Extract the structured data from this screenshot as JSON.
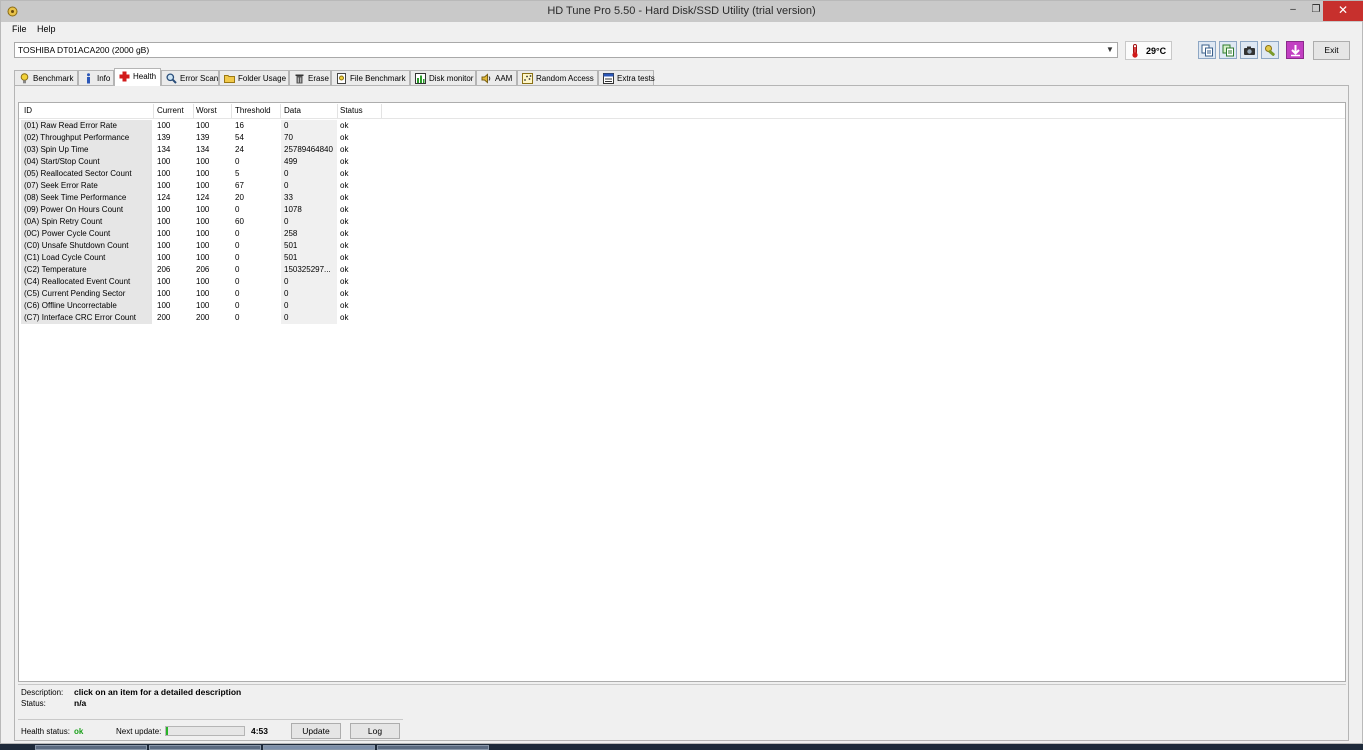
{
  "window": {
    "title": "HD Tune Pro 5.50 - Hard Disk/SSD Utility (trial version)",
    "close_glyph": "✕",
    "min_glyph": "–",
    "max_glyph": "❐"
  },
  "menu": {
    "file": "File",
    "help": "Help"
  },
  "drive": {
    "selected": "TOSHIBA DT01ACA200 (2000 gB)"
  },
  "temperature": {
    "value": "29°C"
  },
  "toolbar": {
    "exit_label": "Exit"
  },
  "tabs": [
    {
      "label": "Benchmark",
      "icon": "lightbulb-icon"
    },
    {
      "label": "Info",
      "icon": "info-icon"
    },
    {
      "label": "Health",
      "icon": "health-cross-icon",
      "active": true
    },
    {
      "label": "Error Scan",
      "icon": "magnifier-icon"
    },
    {
      "label": "Folder Usage",
      "icon": "folder-icon"
    },
    {
      "label": "Erase",
      "icon": "trash-icon"
    },
    {
      "label": "File Benchmark",
      "icon": "file-benchmark-icon"
    },
    {
      "label": "Disk monitor",
      "icon": "chart-icon"
    },
    {
      "label": "AAM",
      "icon": "speaker-icon"
    },
    {
      "label": "Random Access",
      "icon": "random-access-icon"
    },
    {
      "label": "Extra tests",
      "icon": "extra-tests-icon"
    }
  ],
  "table": {
    "headers": [
      "ID",
      "Current",
      "Worst",
      "Threshold",
      "Data",
      "Status"
    ],
    "rows": [
      [
        "(01) Raw Read Error Rate",
        "100",
        "100",
        "16",
        "0",
        "ok"
      ],
      [
        "(02) Throughput Performance",
        "139",
        "139",
        "54",
        "70",
        "ok"
      ],
      [
        "(03) Spin Up Time",
        "134",
        "134",
        "24",
        "25789464840",
        "ok"
      ],
      [
        "(04) Start/Stop Count",
        "100",
        "100",
        "0",
        "499",
        "ok"
      ],
      [
        "(05) Reallocated Sector Count",
        "100",
        "100",
        "5",
        "0",
        "ok"
      ],
      [
        "(07) Seek Error Rate",
        "100",
        "100",
        "67",
        "0",
        "ok"
      ],
      [
        "(08) Seek Time Performance",
        "124",
        "124",
        "20",
        "33",
        "ok"
      ],
      [
        "(09) Power On Hours Count",
        "100",
        "100",
        "0",
        "1078",
        "ok"
      ],
      [
        "(0A) Spin Retry Count",
        "100",
        "100",
        "60",
        "0",
        "ok"
      ],
      [
        "(0C) Power Cycle Count",
        "100",
        "100",
        "0",
        "258",
        "ok"
      ],
      [
        "(C0) Unsafe Shutdown Count",
        "100",
        "100",
        "0",
        "501",
        "ok"
      ],
      [
        "(C1) Load Cycle Count",
        "100",
        "100",
        "0",
        "501",
        "ok"
      ],
      [
        "(C2) Temperature",
        "206",
        "206",
        "0",
        "150325297...",
        "ok"
      ],
      [
        "(C4) Reallocated Event Count",
        "100",
        "100",
        "0",
        "0",
        "ok"
      ],
      [
        "(C5) Current Pending Sector",
        "100",
        "100",
        "0",
        "0",
        "ok"
      ],
      [
        "(C6) Offline Uncorrectable",
        "100",
        "100",
        "0",
        "0",
        "ok"
      ],
      [
        "(C7) Interface CRC Error Count",
        "200",
        "200",
        "0",
        "0",
        "ok"
      ]
    ]
  },
  "description": {
    "label": "Description:",
    "value": "click on an item for a detailed description",
    "status_label": "Status:",
    "status_value": "n/a"
  },
  "health": {
    "label": "Health status:",
    "value": "ok",
    "next_update_label": "Next update:",
    "progress": 0.02,
    "timer": "4:53",
    "update_label": "Update",
    "log_label": "Log"
  },
  "colors": {
    "health_ok": "#1aa01a",
    "close_red": "#c7302d",
    "progress_green": "#27b327"
  }
}
